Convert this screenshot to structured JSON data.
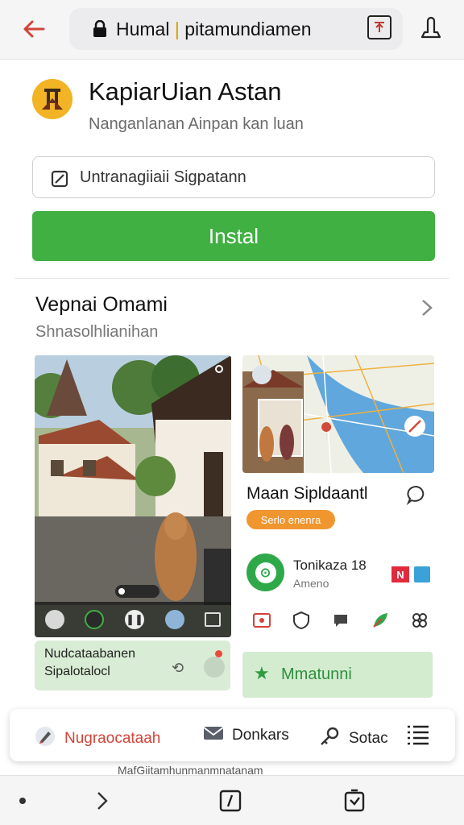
{
  "browser": {
    "url_host": "Humal",
    "url_path": "pitamundiamen"
  },
  "app": {
    "title": "KapiarUian Astan",
    "subtitle": "Nanganlanan Ainpan kan luan"
  },
  "search": {
    "value": "Untranagiiaii Sigpatann"
  },
  "install": {
    "label": "Instal"
  },
  "section": {
    "title": "Vepnai Omami",
    "subtitle": "Shnasolhlianihan"
  },
  "note_card": {
    "line1": "Nudcataabanen",
    "line2": "Sipalotalocl"
  },
  "right_card": {
    "title": "Maan Sipldaantl",
    "badge": "Serlo enenra",
    "name": "Tonikaza 18",
    "meta": "Ameno",
    "n_badge": "N"
  },
  "green_card": {
    "label": "Mmatunni"
  },
  "action_bar": {
    "items": [
      {
        "label": "Nugraocataah",
        "icon": "pen-icon"
      },
      {
        "label": "Donkars",
        "icon": "mail-icon"
      },
      {
        "label": "Sotac",
        "icon": "key-icon"
      }
    ]
  },
  "footer": {
    "text": "MafGiitamhunmanmnatanam"
  },
  "colors": {
    "accent_green": "#3fb041",
    "badge_orange": "#f0962e",
    "back_red": "#d2443a"
  }
}
